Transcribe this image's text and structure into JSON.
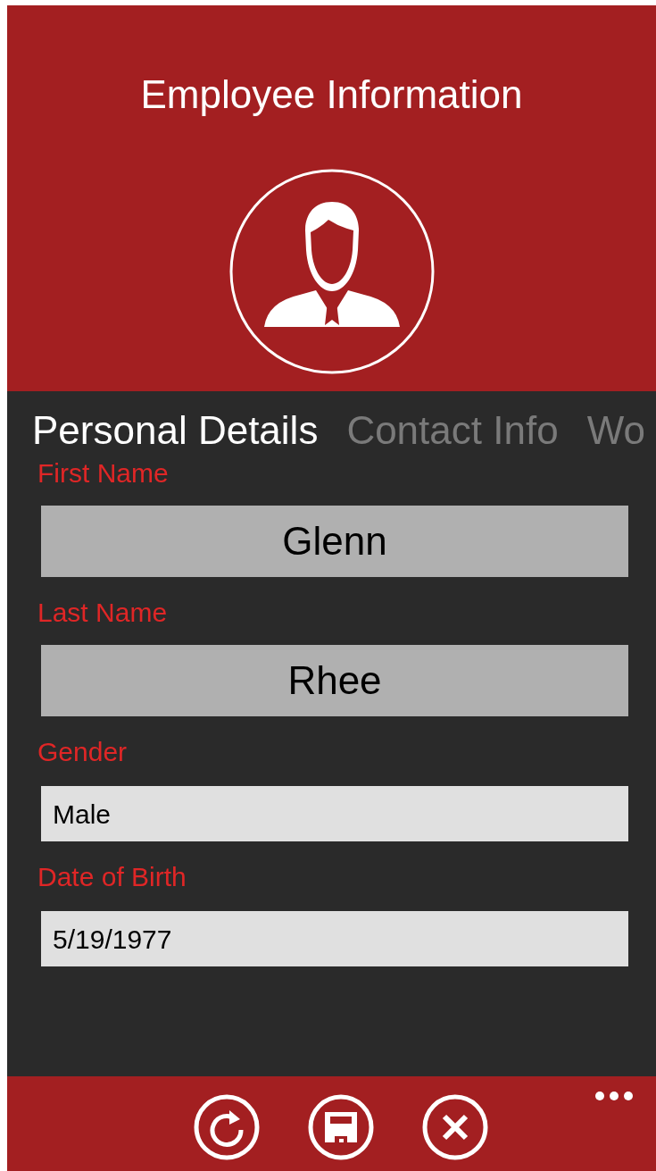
{
  "header": {
    "title": "Employee Information"
  },
  "tabs": [
    {
      "label": "Personal Details",
      "selected": true
    },
    {
      "label": "Contact Info",
      "selected": false
    },
    {
      "label": "Wo",
      "selected": false
    }
  ],
  "fields": [
    {
      "label": "First Name",
      "value": "Glenn",
      "kind": "name"
    },
    {
      "label": "Last Name",
      "value": "Rhee",
      "kind": "name"
    },
    {
      "label": "Gender",
      "value": "Male",
      "kind": "text"
    },
    {
      "label": "Date of Birth",
      "value": "5/19/1977",
      "kind": "text"
    }
  ],
  "app_bar": {
    "buttons": [
      {
        "kind": "refresh"
      },
      {
        "kind": "save"
      },
      {
        "kind": "cancel"
      }
    ]
  }
}
